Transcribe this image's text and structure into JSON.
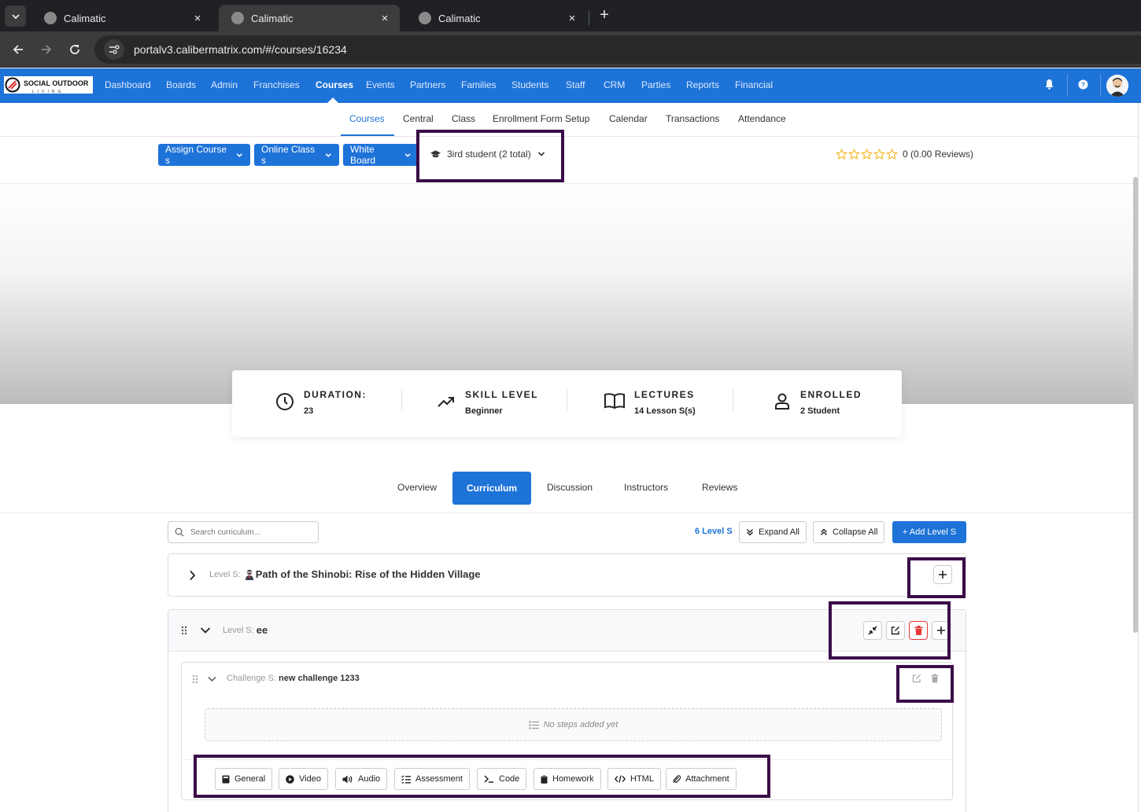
{
  "browser": {
    "tabs": [
      {
        "title": "Calimatic",
        "active": false
      },
      {
        "title": "Calimatic",
        "active": true
      },
      {
        "title": "Calimatic",
        "active": false
      }
    ],
    "close_glyph": "×",
    "new_tab_glyph": "+",
    "url": "portalv3.calibermatrix.com/#/courses/16234"
  },
  "app": {
    "logo_text": "SOCIAL OUTDOOR",
    "logo_sub": "LIVING",
    "nav": [
      "Dashboard",
      "Boards",
      "Admin",
      "Franchises",
      "Courses",
      "Events",
      "Partners",
      "Families",
      "Students",
      "Staff",
      "CRM",
      "Parties",
      "Reports",
      "Financial"
    ],
    "nav_active": "Courses",
    "subnav": [
      "Courses",
      "Central",
      "Class",
      "Enrollment Form Setup",
      "Calendar",
      "Transactions",
      "Attendance"
    ],
    "subnav_active": "Courses"
  },
  "toolbar": {
    "assign_course": "Assign Course s",
    "online_class": "Online Class s",
    "white_board": "White Board",
    "student_dropdown": "3ird student (2 total)",
    "rating_text": "0 (0.00 Reviews)",
    "rating_value": 0,
    "rating_max": 5
  },
  "stats": {
    "duration_label": "DURATION:",
    "duration_value": "23",
    "skill_label": "SKILL LEVEL",
    "skill_value": "Beginner",
    "lectures_label": "LECTURES",
    "lectures_value": "14 Lesson S(s)",
    "enrolled_label": "ENROLLED",
    "enrolled_value": "2 Student"
  },
  "content_tabs": [
    "Overview",
    "Curriculum",
    "Discussion",
    "Instructors",
    "Reviews"
  ],
  "content_tab_active": "Curriculum",
  "curriculum": {
    "search_placeholder": "Search curriculum...",
    "levels_count": "6 Level S",
    "expand_all": "Expand All",
    "collapse_all": "Collapse All",
    "add_level": "+ Add Level S",
    "levels": [
      {
        "prefix": "Level S:",
        "title": "Path of the Shinobi: Rise of the Hidden Village",
        "expanded": false
      },
      {
        "prefix": "Level S:",
        "title": "ee",
        "expanded": true
      }
    ],
    "challenge": {
      "prefix": "Challenge S:",
      "title": "new challenge 1233"
    },
    "empty_steps": "No steps added yet",
    "step_types": [
      "General",
      "Video",
      "Audio",
      "Assessment",
      "Code",
      "Homework",
      "HTML",
      "Attachment"
    ]
  },
  "colors": {
    "primary": "#1e73d8",
    "highlight": "#3b0c48",
    "danger": "#e53935"
  }
}
